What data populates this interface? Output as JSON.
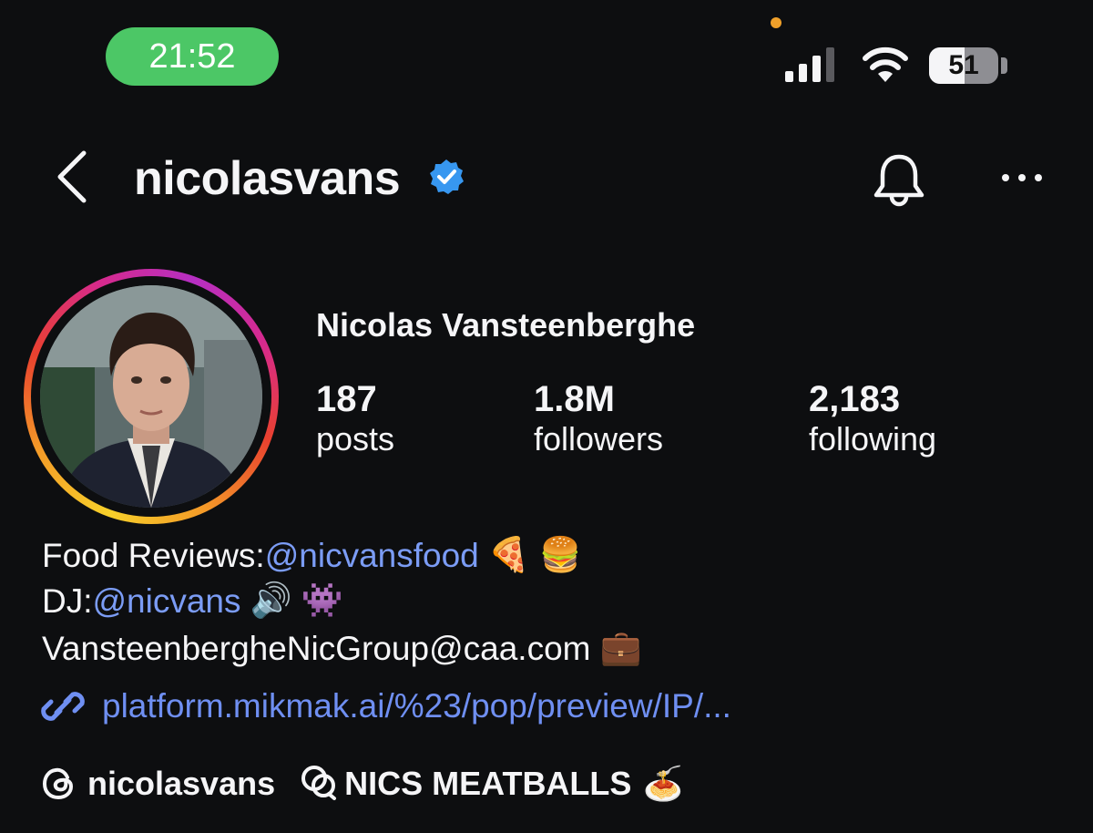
{
  "status_bar": {
    "time": "21:52",
    "battery_level": 51,
    "battery_text": "51",
    "icons": [
      "cellular-signal-icon",
      "wifi-icon",
      "battery-icon",
      "privacy-indicator-dot"
    ],
    "accent_colors": {
      "time_pill": "#4cc766",
      "privacy_dot": "#f0a02a"
    }
  },
  "header": {
    "username": "nicolasvans",
    "icons": [
      "back-chevron-icon",
      "verified-badge-icon",
      "notification-bell-icon",
      "more-options-icon"
    ],
    "verified_color": "#3797f0"
  },
  "profile": {
    "full_name": "Nicolas Vansteenberghe",
    "stats": [
      {
        "value": "187",
        "label": "posts"
      },
      {
        "value": "1.8M",
        "label": "followers"
      },
      {
        "value": "2,183",
        "label": "following"
      }
    ]
  },
  "bio": {
    "line1_prefix": "Food Reviews: ",
    "line1_mention": "@nicvansfood",
    "line1_emojis": "🍕 🍔",
    "line2_prefix": "DJ: ",
    "line2_mention": "@nicvans",
    "line2_emojis": "🔊 👾",
    "line3_email": "VansteenbergheNicGroup@caa.com",
    "line3_emoji": "💼",
    "link": "platform.mikmak.ai/%23/pop/preview/IP/..."
  },
  "threads": {
    "handle": "nicolasvans",
    "badge_text": "NICS MEATBALLS",
    "badge_emoji": "🍝"
  }
}
